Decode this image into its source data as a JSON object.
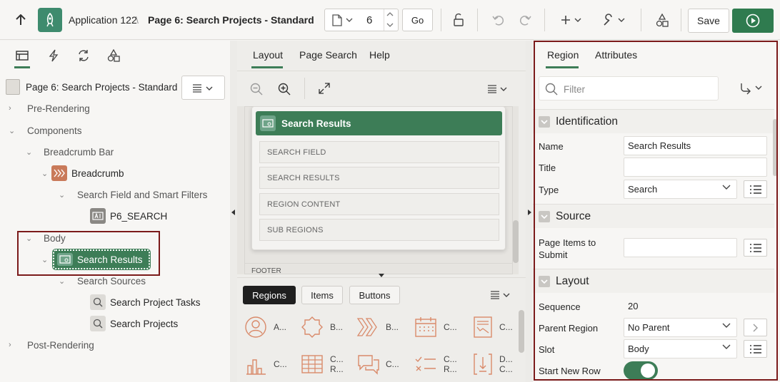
{
  "toolbar": {
    "app_name": "Application 122",
    "page_name": "Page 6: Search Projects - Standard",
    "page_number": "6",
    "go_label": "Go",
    "save_label": "Save",
    "crumb_sep": "\\"
  },
  "left_panel": {
    "page_header": "Page 6: Search Projects - Standard",
    "tree": {
      "pre_rendering": "Pre-Rendering",
      "components": "Components",
      "breadcrumb_bar": "Breadcrumb Bar",
      "breadcrumb": "Breadcrumb",
      "search_field_filters": "Search Field and Smart Filters",
      "p6_search": "P6_SEARCH",
      "body": "Body",
      "search_results": "Search Results",
      "search_sources": "Search Sources",
      "search_project_tasks": "Search Project Tasks",
      "search_projects": "Search Projects",
      "post_rendering": "Post-Rendering"
    }
  },
  "middle_panel": {
    "tabs": [
      "Layout",
      "Page Search",
      "Help"
    ],
    "region_title": "Search Results",
    "slots": [
      "SEARCH FIELD",
      "SEARCH RESULTS",
      "REGION CONTENT",
      "SUB REGIONS"
    ],
    "footer": "FOOTER",
    "gallery_tabs": [
      "Regions",
      "Items",
      "Buttons"
    ],
    "gallery_row1": [
      "A...",
      "B...",
      "B...",
      "C...",
      "C..."
    ],
    "gallery_row2": [
      {
        "l1": "C...",
        "l2": ""
      },
      {
        "l1": "C...",
        "l2": "R..."
      },
      {
        "l1": "C...",
        "l2": ""
      },
      {
        "l1": "C...",
        "l2": "R..."
      },
      {
        "l1": "D...",
        "l2": "C..."
      }
    ]
  },
  "right_panel": {
    "tabs": [
      "Region",
      "Attributes"
    ],
    "filter_placeholder": "Filter",
    "sections": {
      "identification": "Identification",
      "source": "Source",
      "layout": "Layout"
    },
    "props": {
      "name_label": "Name",
      "name_value": "Search Results",
      "title_label": "Title",
      "title_value": "",
      "type_label": "Type",
      "type_value": "Search",
      "items_submit_label_1": "Page Items to",
      "items_submit_label_2": "Submit",
      "sequence_label": "Sequence",
      "sequence_value": "20",
      "parent_label": "Parent Region",
      "parent_value": "No Parent",
      "slot_label": "Slot",
      "slot_value": "Body",
      "new_row_label": "Start New Row",
      "new_row_on": true
    }
  },
  "colors": {
    "accent_green": "#3d7d57",
    "run_green": "#2f7b4f",
    "highlight_red": "#7b1a1a",
    "breadcrumb_icon": "#c97a5a"
  }
}
